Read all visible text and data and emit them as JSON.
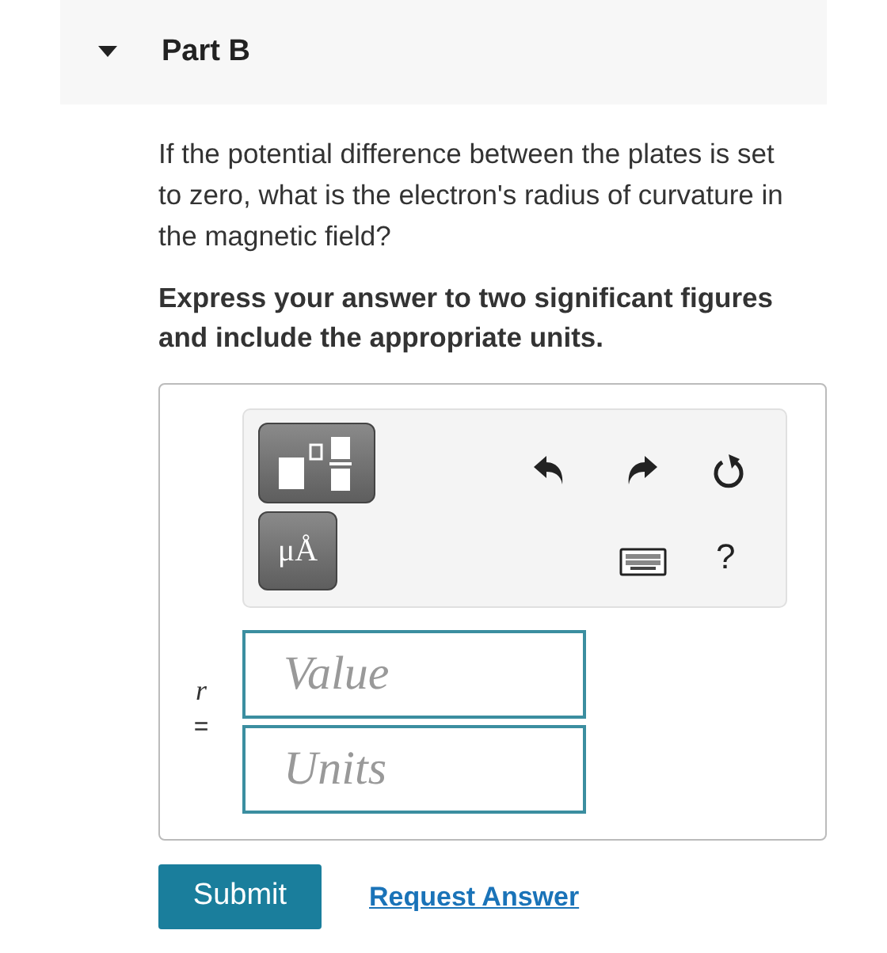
{
  "part": {
    "title": "Part B",
    "expanded": true
  },
  "question": "If the potential difference between the plates is set to zero, what is the electron's radius of curvature in the magnetic field?",
  "instruction": "Express your answer to two significant figures and include the appropriate units.",
  "toolbar": {
    "units_button": "μÅ",
    "help": "?"
  },
  "answer": {
    "variable": "r",
    "equals": "=",
    "value_placeholder": "Value",
    "units_placeholder": "Units"
  },
  "buttons": {
    "submit": "Submit",
    "request_answer": "Request Answer"
  }
}
